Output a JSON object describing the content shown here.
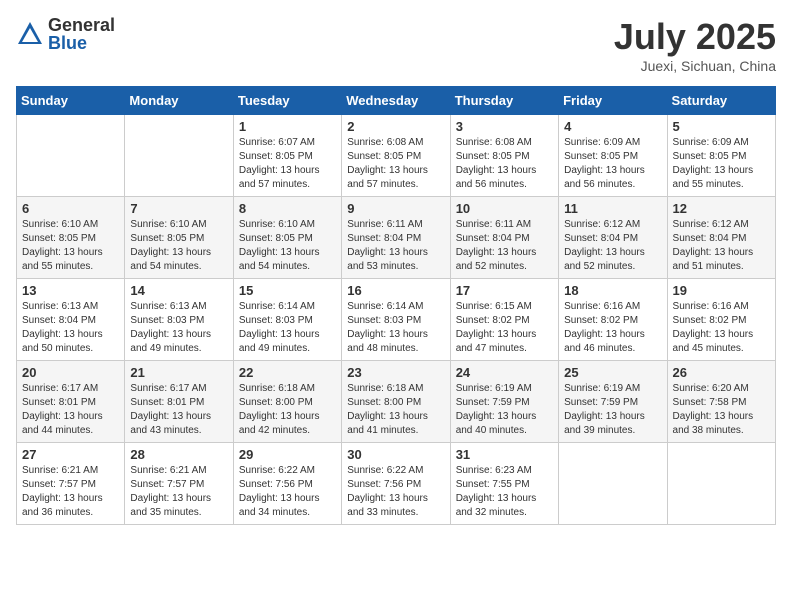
{
  "logo": {
    "general": "General",
    "blue": "Blue"
  },
  "header": {
    "month": "July 2025",
    "location": "Juexi, Sichuan, China"
  },
  "days_of_week": [
    "Sunday",
    "Monday",
    "Tuesday",
    "Wednesday",
    "Thursday",
    "Friday",
    "Saturday"
  ],
  "weeks": [
    [
      {
        "day": "",
        "info": ""
      },
      {
        "day": "",
        "info": ""
      },
      {
        "day": "1",
        "info": "Sunrise: 6:07 AM\nSunset: 8:05 PM\nDaylight: 13 hours and 57 minutes."
      },
      {
        "day": "2",
        "info": "Sunrise: 6:08 AM\nSunset: 8:05 PM\nDaylight: 13 hours and 57 minutes."
      },
      {
        "day": "3",
        "info": "Sunrise: 6:08 AM\nSunset: 8:05 PM\nDaylight: 13 hours and 56 minutes."
      },
      {
        "day": "4",
        "info": "Sunrise: 6:09 AM\nSunset: 8:05 PM\nDaylight: 13 hours and 56 minutes."
      },
      {
        "day": "5",
        "info": "Sunrise: 6:09 AM\nSunset: 8:05 PM\nDaylight: 13 hours and 55 minutes."
      }
    ],
    [
      {
        "day": "6",
        "info": "Sunrise: 6:10 AM\nSunset: 8:05 PM\nDaylight: 13 hours and 55 minutes."
      },
      {
        "day": "7",
        "info": "Sunrise: 6:10 AM\nSunset: 8:05 PM\nDaylight: 13 hours and 54 minutes."
      },
      {
        "day": "8",
        "info": "Sunrise: 6:10 AM\nSunset: 8:05 PM\nDaylight: 13 hours and 54 minutes."
      },
      {
        "day": "9",
        "info": "Sunrise: 6:11 AM\nSunset: 8:04 PM\nDaylight: 13 hours and 53 minutes."
      },
      {
        "day": "10",
        "info": "Sunrise: 6:11 AM\nSunset: 8:04 PM\nDaylight: 13 hours and 52 minutes."
      },
      {
        "day": "11",
        "info": "Sunrise: 6:12 AM\nSunset: 8:04 PM\nDaylight: 13 hours and 52 minutes."
      },
      {
        "day": "12",
        "info": "Sunrise: 6:12 AM\nSunset: 8:04 PM\nDaylight: 13 hours and 51 minutes."
      }
    ],
    [
      {
        "day": "13",
        "info": "Sunrise: 6:13 AM\nSunset: 8:04 PM\nDaylight: 13 hours and 50 minutes."
      },
      {
        "day": "14",
        "info": "Sunrise: 6:13 AM\nSunset: 8:03 PM\nDaylight: 13 hours and 49 minutes."
      },
      {
        "day": "15",
        "info": "Sunrise: 6:14 AM\nSunset: 8:03 PM\nDaylight: 13 hours and 49 minutes."
      },
      {
        "day": "16",
        "info": "Sunrise: 6:14 AM\nSunset: 8:03 PM\nDaylight: 13 hours and 48 minutes."
      },
      {
        "day": "17",
        "info": "Sunrise: 6:15 AM\nSunset: 8:02 PM\nDaylight: 13 hours and 47 minutes."
      },
      {
        "day": "18",
        "info": "Sunrise: 6:16 AM\nSunset: 8:02 PM\nDaylight: 13 hours and 46 minutes."
      },
      {
        "day": "19",
        "info": "Sunrise: 6:16 AM\nSunset: 8:02 PM\nDaylight: 13 hours and 45 minutes."
      }
    ],
    [
      {
        "day": "20",
        "info": "Sunrise: 6:17 AM\nSunset: 8:01 PM\nDaylight: 13 hours and 44 minutes."
      },
      {
        "day": "21",
        "info": "Sunrise: 6:17 AM\nSunset: 8:01 PM\nDaylight: 13 hours and 43 minutes."
      },
      {
        "day": "22",
        "info": "Sunrise: 6:18 AM\nSunset: 8:00 PM\nDaylight: 13 hours and 42 minutes."
      },
      {
        "day": "23",
        "info": "Sunrise: 6:18 AM\nSunset: 8:00 PM\nDaylight: 13 hours and 41 minutes."
      },
      {
        "day": "24",
        "info": "Sunrise: 6:19 AM\nSunset: 7:59 PM\nDaylight: 13 hours and 40 minutes."
      },
      {
        "day": "25",
        "info": "Sunrise: 6:19 AM\nSunset: 7:59 PM\nDaylight: 13 hours and 39 minutes."
      },
      {
        "day": "26",
        "info": "Sunrise: 6:20 AM\nSunset: 7:58 PM\nDaylight: 13 hours and 38 minutes."
      }
    ],
    [
      {
        "day": "27",
        "info": "Sunrise: 6:21 AM\nSunset: 7:57 PM\nDaylight: 13 hours and 36 minutes."
      },
      {
        "day": "28",
        "info": "Sunrise: 6:21 AM\nSunset: 7:57 PM\nDaylight: 13 hours and 35 minutes."
      },
      {
        "day": "29",
        "info": "Sunrise: 6:22 AM\nSunset: 7:56 PM\nDaylight: 13 hours and 34 minutes."
      },
      {
        "day": "30",
        "info": "Sunrise: 6:22 AM\nSunset: 7:56 PM\nDaylight: 13 hours and 33 minutes."
      },
      {
        "day": "31",
        "info": "Sunrise: 6:23 AM\nSunset: 7:55 PM\nDaylight: 13 hours and 32 minutes."
      },
      {
        "day": "",
        "info": ""
      },
      {
        "day": "",
        "info": ""
      }
    ]
  ]
}
